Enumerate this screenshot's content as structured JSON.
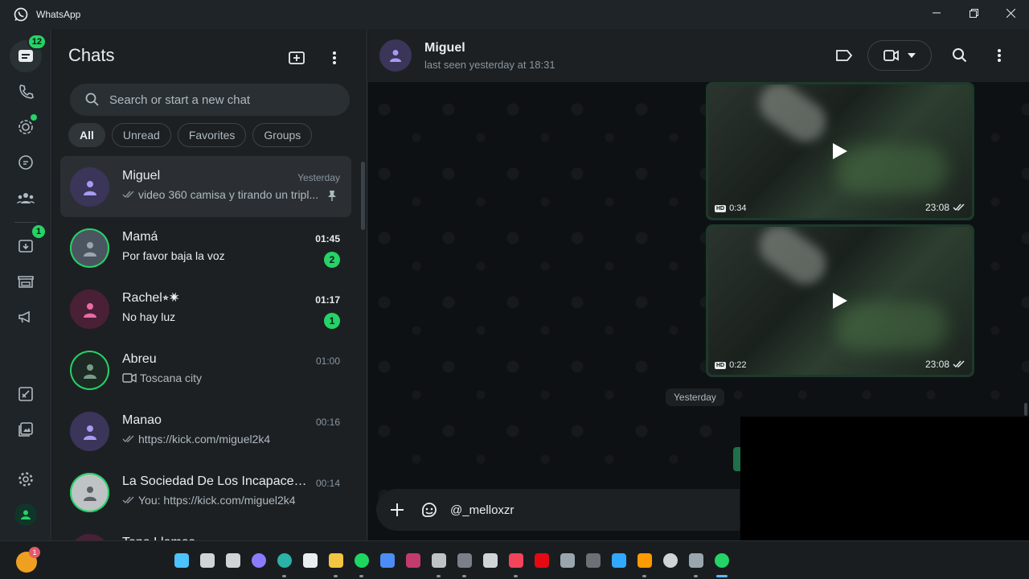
{
  "window": {
    "title": "WhatsApp",
    "icon": "whatsapp-logo-icon",
    "controls": [
      "minimize-icon",
      "restore-icon",
      "close-icon"
    ]
  },
  "rail": {
    "chats_badge": "12",
    "updates_badge": "1",
    "items": [
      "chats-icon",
      "calls-icon",
      "status-icon",
      "channels-icon",
      "communities-icon",
      "archived-icon",
      "business-tools-icon",
      "advertise-icon",
      "starred-icon",
      "media-icon",
      "settings-icon",
      "profile-avatar"
    ]
  },
  "chatlist": {
    "title": "Chats",
    "search_placeholder": "Search or start a new chat",
    "filters": [
      "All",
      "Unread",
      "Favorites",
      "Groups"
    ],
    "chats": [
      {
        "name": "Miguel",
        "time": "Yesterday",
        "preview": "video 360 camisa y tirando un tripl...",
        "ticks": true,
        "pinned": true,
        "unread": "",
        "avatar_color": "#3a3559",
        "avatar_icon": "person-icon",
        "icon_color": "#a79af0"
      },
      {
        "name": "Mamá",
        "time": "01:45",
        "preview": "Por favor baja la voz",
        "ticks": false,
        "pinned": false,
        "unread": "2",
        "avatar_color": "#4b5560",
        "avatar_icon": "photo",
        "icon_color": "#9aa6ae"
      },
      {
        "name": "Rachel⭒✷",
        "time": "01:17",
        "preview": "No hay luz",
        "ticks": false,
        "pinned": false,
        "unread": "1",
        "avatar_color": "#4a2037",
        "avatar_icon": "person-icon",
        "icon_color": "#e86ba5"
      },
      {
        "name": "Abreu",
        "time": "01:00",
        "preview": "Toscana city",
        "ticks": false,
        "pinned": false,
        "unread": "",
        "video": true,
        "avatar_color": "#1d2a24",
        "avatar_icon": "photo",
        "icon_color": "#7a9a86"
      },
      {
        "name": "Manao",
        "time": "00:16",
        "preview": "https://kick.com/miguel2k4",
        "ticks": true,
        "pinned": false,
        "unread": "",
        "avatar_color": "#3a3559",
        "avatar_icon": "person-icon",
        "icon_color": "#a79af0"
      },
      {
        "name": "La Sociedad De Los Incapaces ...",
        "time": "00:14",
        "preview": "You: https://kick.com/miguel2k4",
        "ticks": true,
        "pinned": false,
        "unread": "",
        "avatar_color": "#bfc3c6",
        "avatar_icon": "photo",
        "icon_color": "#5a5f63"
      },
      {
        "name": "Tono Llamas",
        "time": "",
        "preview": "",
        "ticks": false,
        "pinned": false,
        "unread": "",
        "avatar_color": "#4a2037",
        "avatar_icon": "person-icon",
        "icon_color": "#e86ba5"
      }
    ]
  },
  "conversation": {
    "name": "Miguel",
    "status": "last seen yesterday at 18:31",
    "messages": [
      {
        "type": "video",
        "hd": "HD",
        "duration": "0:34",
        "time": "23:08"
      },
      {
        "type": "video",
        "hd": "HD",
        "duration": "0:22",
        "time": "23:08"
      }
    ],
    "day_separator": "Yesterday",
    "composer_text": "@_melloxzr"
  },
  "taskbar": {
    "weather_badge": "1",
    "icons": [
      {
        "name": "windows-start-icon",
        "color": "#4cc2ff"
      },
      {
        "name": "search-icon",
        "color": "#d0d4d8"
      },
      {
        "name": "task-view-icon",
        "color": "#d0d4d8"
      },
      {
        "name": "copilot-icon",
        "color": "#8a7cff"
      },
      {
        "name": "edge-icon",
        "color": "#2ab3a6"
      },
      {
        "name": "store-icon",
        "color": "#e9edef"
      },
      {
        "name": "file-explorer-icon",
        "color": "#f4c542"
      },
      {
        "name": "spotify-icon",
        "color": "#1ed760"
      },
      {
        "name": "defender-icon",
        "color": "#4c8cf5"
      },
      {
        "name": "app-icon-1",
        "color": "#c23b6e"
      },
      {
        "name": "app-icon-2",
        "color": "#bfc3c6"
      },
      {
        "name": "app-icon-3",
        "color": "#7a8088"
      },
      {
        "name": "app-icon-4",
        "color": "#d0d4d8"
      },
      {
        "name": "music-icon",
        "color": "#f2445b"
      },
      {
        "name": "netflix-icon",
        "color": "#e50914"
      },
      {
        "name": "calculator-icon",
        "color": "#9aa6ae"
      },
      {
        "name": "app-icon-5",
        "color": "#6a7075"
      },
      {
        "name": "photoshop-icon",
        "color": "#31a8ff"
      },
      {
        "name": "illustrator-icon",
        "color": "#ff9a00"
      },
      {
        "name": "obs-icon",
        "color": "#d0d4d8"
      },
      {
        "name": "settings-icon",
        "color": "#9aa6ae"
      },
      {
        "name": "whatsapp-icon",
        "color": "#25d366"
      }
    ]
  }
}
